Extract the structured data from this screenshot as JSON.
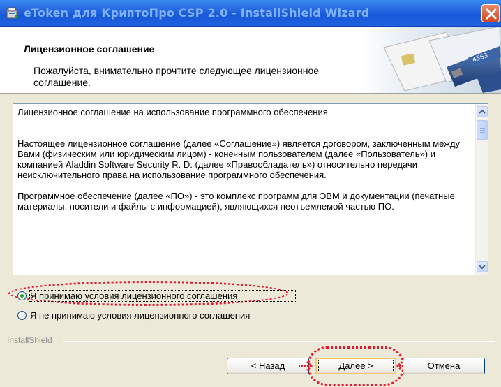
{
  "window": {
    "title": "eToken для КриптоПро CSP 2.0 - InstallShield Wizard"
  },
  "header": {
    "title": "Лицензионное соглашение",
    "description": "Пожалуйста, внимательно прочтите следующее лицензионное соглашение."
  },
  "license": {
    "heading": "Лицензионное соглашение на использование программного обеспечения",
    "rule": "================================================================",
    "paragraph1": "Настоящее лицензионное соглашение (далее «Соглашение») является договором, заключенным между Вами (физическим или юридическим лицом) - конечным пользователем (далее «Пользователь») и компанией Aladdin Software Security R. D. (далее «Правообладатель») относительно передачи неисключительного права на использование программного обеспечения.",
    "paragraph2": "Программное обеспечение (далее «ПО») - это комплекс программ для ЭВМ и документации (печатные материалы, носители и файлы с информацией), являющихся неотъемлемой частью ПО."
  },
  "options": {
    "accept_label": "Я принимаю условия лицензионного соглашения",
    "decline_label": "Я не принимаю условия лицензионного соглашения",
    "selected": "accept"
  },
  "footer": {
    "brand": "InstallShield",
    "back_prefix": "< ",
    "back_key": "Н",
    "back_rest": "азад",
    "next_key": "Д",
    "next_rest": "алее >",
    "cancel_label": "Отмена"
  },
  "colors": {
    "title_bar": "#2a6ee4",
    "highlight": "#e6162e",
    "radio_selected": "#21a121"
  }
}
